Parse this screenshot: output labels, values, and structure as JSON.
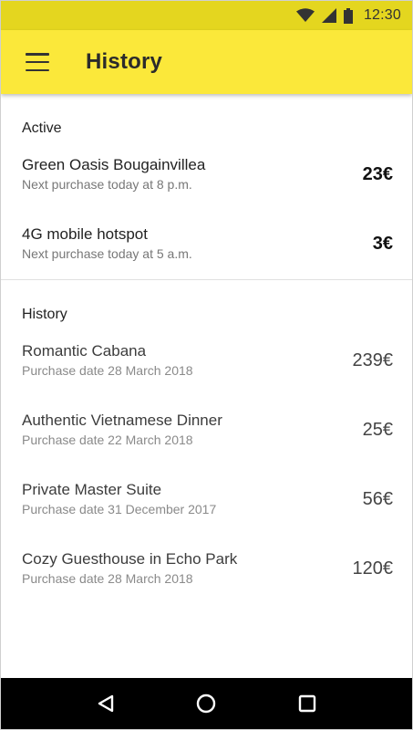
{
  "status_bar": {
    "time": "12:30",
    "icons": [
      "wifi-icon",
      "cell-signal-icon",
      "battery-icon"
    ],
    "background": "#e4d61f"
  },
  "app_bar": {
    "title": "History",
    "menu_icon": "hamburger-menu-icon",
    "background": "#fbe83a"
  },
  "active": {
    "heading": "Active",
    "items": [
      {
        "title": "Green Oasis Bougainvillea",
        "subtitle": "Next purchase today at 8 p.m.",
        "price": "23€"
      },
      {
        "title": "4G mobile hotspot",
        "subtitle": "Next purchase today at 5 a.m.",
        "price": "3€"
      }
    ]
  },
  "history": {
    "heading": "History",
    "items": [
      {
        "title": "Romantic Cabana",
        "subtitle": "Purchase date 28 March 2018",
        "price": "239€"
      },
      {
        "title": "Authentic Vietnamese Dinner",
        "subtitle": "Purchase date 22 March 2018",
        "price": "25€"
      },
      {
        "title": "Private Master Suite",
        "subtitle": "Purchase date 31 December 2017",
        "price": "56€"
      },
      {
        "title": "Cozy Guesthouse in Echo Park",
        "subtitle": "Purchase date 28 March 2018",
        "price": "120€"
      }
    ]
  },
  "nav_bar": {
    "buttons": [
      "back-triangle-icon",
      "home-circle-icon",
      "recents-square-icon"
    ]
  }
}
